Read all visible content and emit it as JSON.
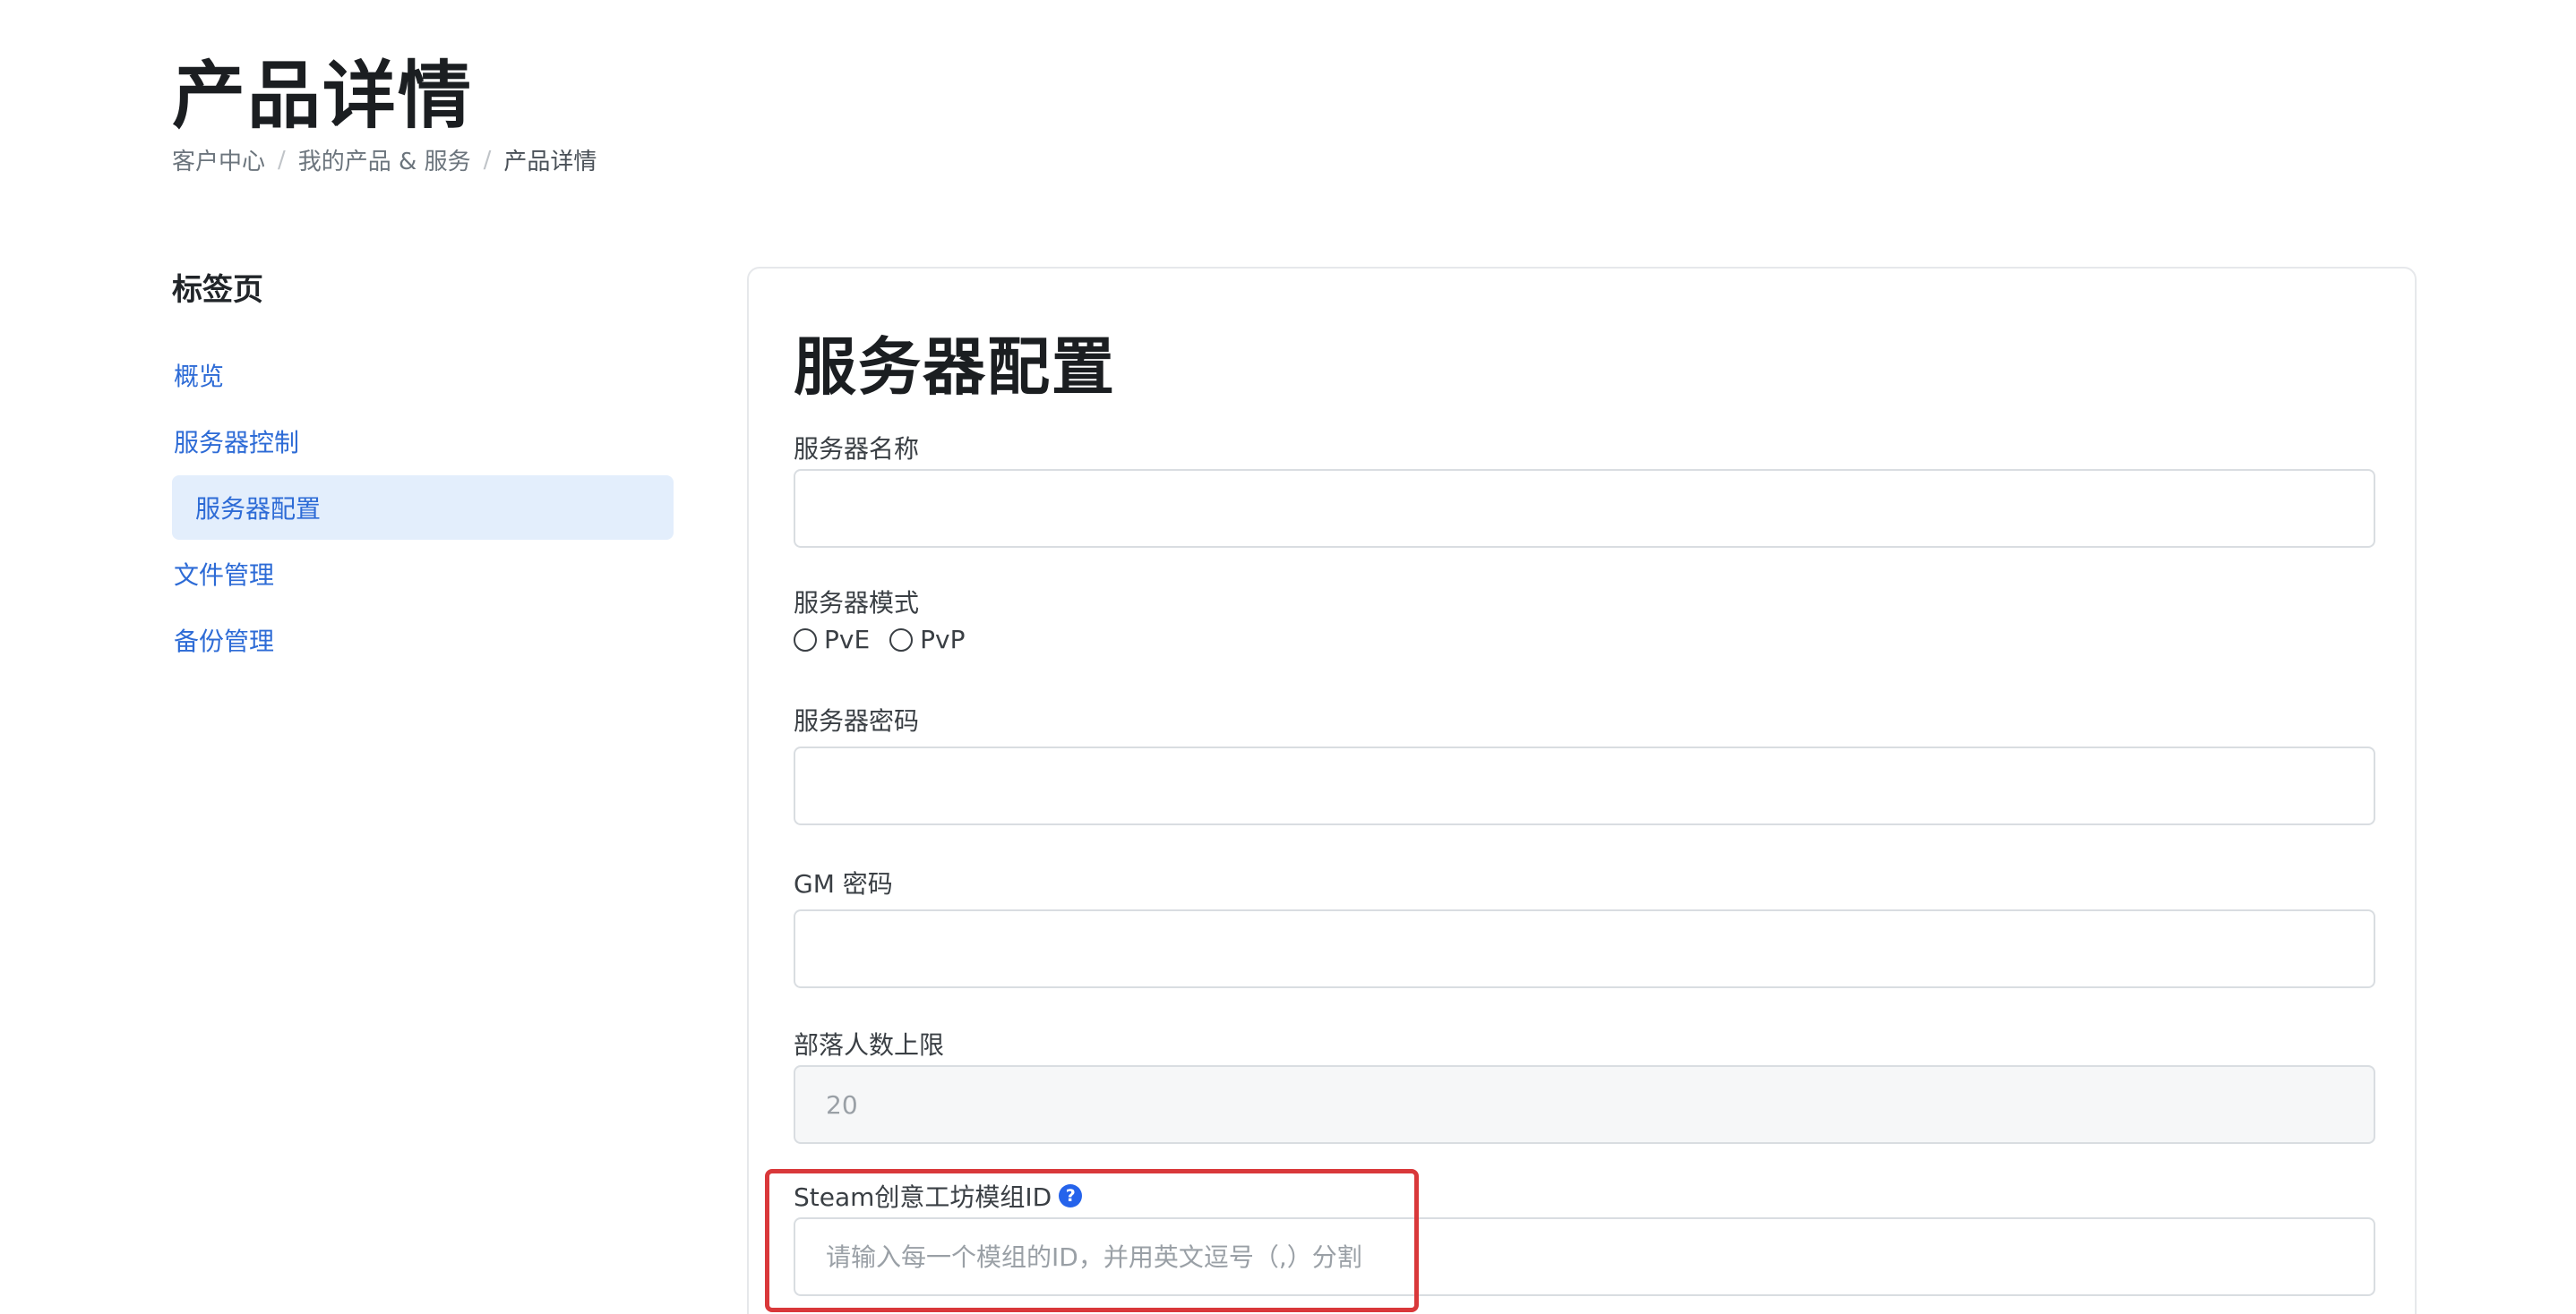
{
  "header": {
    "title": "产品详情",
    "breadcrumb": {
      "items": [
        "客户中心",
        "我的产品 & 服务",
        "产品详情"
      ],
      "separator": "/"
    }
  },
  "sidebar": {
    "title": "标签页",
    "items": [
      {
        "label": "概览"
      },
      {
        "label": "服务器控制"
      },
      {
        "label": "服务器配置"
      },
      {
        "label": "文件管理"
      },
      {
        "label": "备份管理"
      }
    ]
  },
  "main": {
    "title": "服务器配置",
    "fields": {
      "server_name": {
        "label": "服务器名称",
        "value": ""
      },
      "server_mode": {
        "label": "服务器模式",
        "options": [
          "PvE",
          "PvP"
        ]
      },
      "server_password": {
        "label": "服务器密码",
        "value": ""
      },
      "gm_password": {
        "label": "GM 密码",
        "value": ""
      },
      "tribe_limit": {
        "label": "部落人数上限",
        "value": "20"
      },
      "workshop_ids": {
        "label": "Steam创意工坊模组ID",
        "placeholder": "请输入每一个模组的ID，并用英文逗号（,）分割",
        "help_icon": "?"
      }
    }
  },
  "colors": {
    "link": "#2d6bd6",
    "active_bg": "#e3eefc",
    "highlight": "#d9383a",
    "help_icon": "#2563eb"
  }
}
